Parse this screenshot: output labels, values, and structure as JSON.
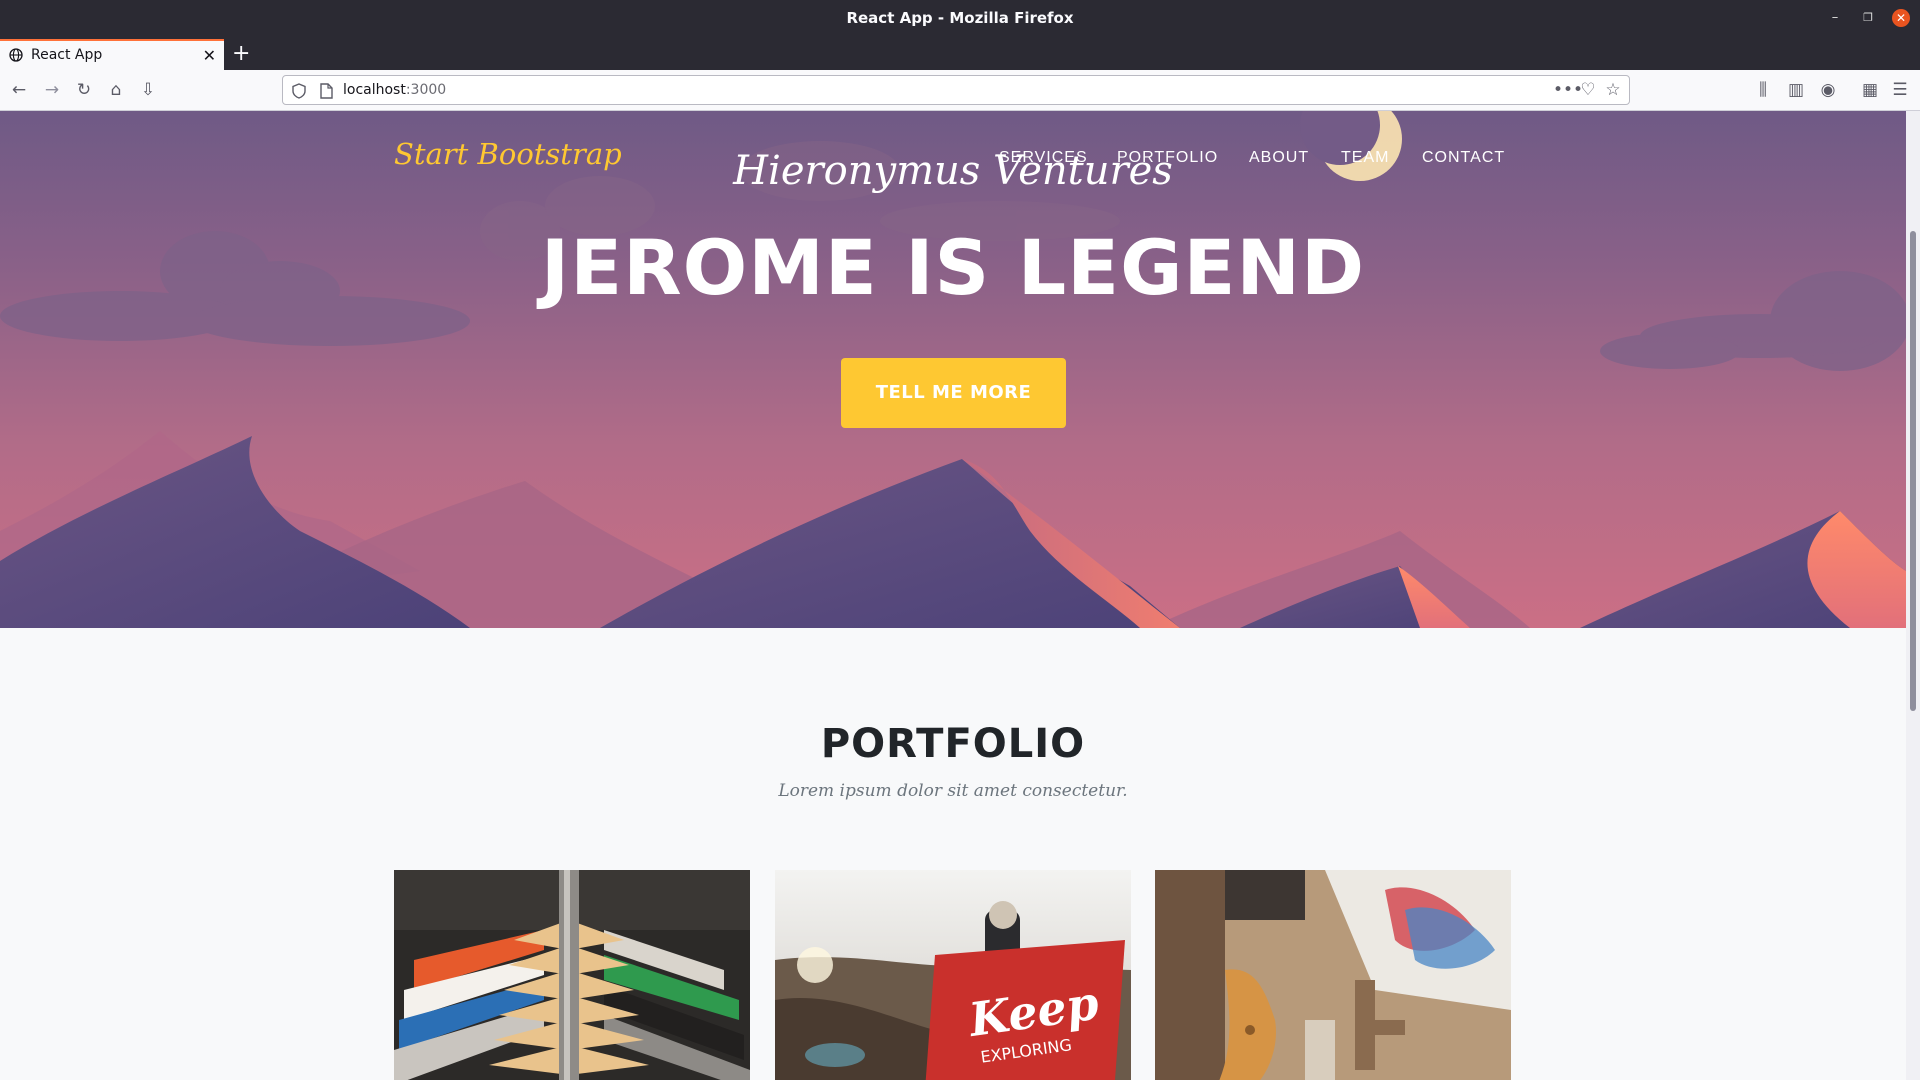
{
  "window": {
    "title": "React App - Mozilla Firefox"
  },
  "tabs": [
    {
      "label": "React App",
      "active": true
    }
  ],
  "addressbar": {
    "host": "localhost",
    "port": ":3000"
  },
  "site": {
    "brand": "Start Bootstrap",
    "company": "Hieronymus Ventures",
    "nav": [
      "SERVICES",
      "PORTFOLIO",
      "ABOUT",
      "TEAM",
      "CONTACT"
    ],
    "headline": "JEROME IS LEGEND",
    "cta": "TELL ME MORE",
    "portfolio": {
      "title": "PORTFOLIO",
      "subtitle": "Lorem ipsum dolor sit amet consectetur.",
      "items": [
        {
          "image": "clothes-rack-photo"
        },
        {
          "image": "keep-exploring-flag-photo",
          "overlay_text": "Keep",
          "overlay_subtext": "EXPLORING"
        },
        {
          "image": "workbench-letters-photo"
        }
      ]
    }
  },
  "colors": {
    "accent": "#fec832",
    "firefox_tab_line": "#ff7139",
    "close_button": "#e95420",
    "dark_text": "#212529"
  }
}
